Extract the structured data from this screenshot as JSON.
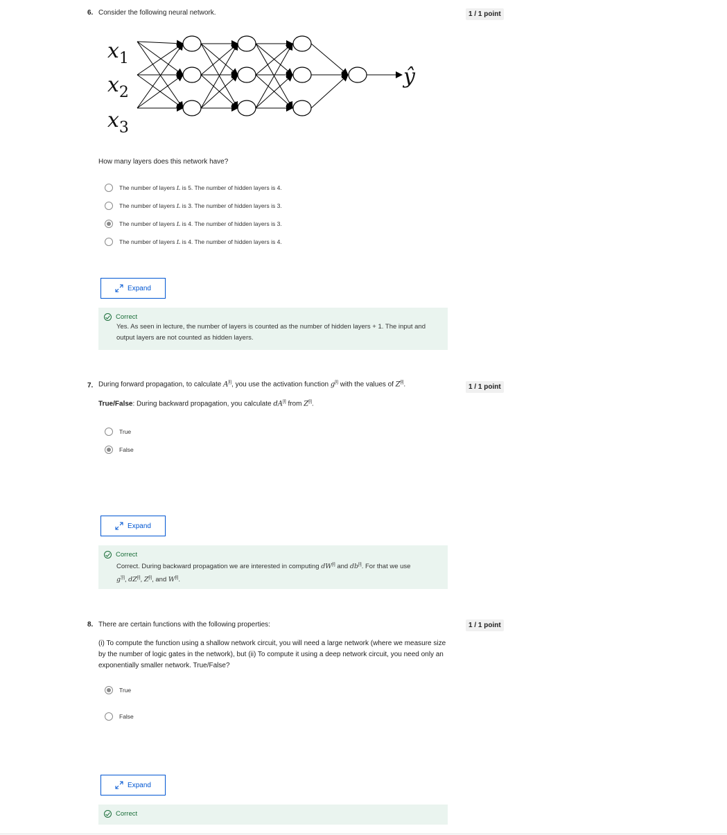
{
  "q6": {
    "number": "6.",
    "prompt": "Consider the following neural network.",
    "points": "1 / 1 point",
    "diagram": {
      "inputs": [
        "x",
        "x",
        "x"
      ],
      "input_subs": [
        "1",
        "2",
        "3"
      ],
      "output": "ŷ"
    },
    "question": "How many layers does this network have?",
    "options": [
      {
        "pre": "The number of layers ",
        "var": "L",
        "post": " is 5. The number of hidden layers is 4.",
        "selected": false
      },
      {
        "pre": "The number of layers ",
        "var": "L",
        "post": " is 3. The number of hidden layers is 3.",
        "selected": false
      },
      {
        "pre": "The number of layers ",
        "var": "L",
        "post": " is 4. The number of hidden layers is 3.",
        "selected": true
      },
      {
        "pre": "The number of layers ",
        "var": "L",
        "post": " is 4. The number of hidden layers is 4.",
        "selected": false
      }
    ],
    "expand_label": "Expand",
    "feedback_title": "Correct",
    "feedback_line1": "Yes. As seen in lecture, the number of layers is counted as the number of hidden layers + 1. The input and",
    "feedback_line2": "output layers are not counted as hidden layers."
  },
  "q7": {
    "number": "7.",
    "points": "1 / 1 point",
    "line1_a": "During forward propagation, to calculate ",
    "line1_A": "A",
    "line1_b": ", you use the activation function ",
    "line1_g": "g",
    "line1_c": " with the values of ",
    "line1_Z": "Z",
    "line1_d": ".",
    "tf_bold": "True/False",
    "line2_a": ": During backward propagation, you calculate ",
    "line2_dA": "dA",
    "line2_b": " from ",
    "line2_Z": "Z",
    "line2_c": ".",
    "sup_l": "[l]",
    "options": [
      {
        "label": "True",
        "selected": false
      },
      {
        "label": "False",
        "selected": true
      }
    ],
    "expand_label": "Expand",
    "feedback_title": "Correct",
    "fb1_a": "Correct. During backward propagation we are interested in computing ",
    "fb1_dW": "dW",
    "fb1_b": " and ",
    "fb1_db": "db",
    "fb1_c": ". For that we use",
    "fb2_g": "g",
    "fb2_gsup": "′[l]",
    "fb2_dZ": "dZ",
    "fb2_Z": "Z",
    "fb2_and": ", and ",
    "fb2_W": "W",
    "fb2_end": "."
  },
  "q8": {
    "number": "8.",
    "points": "1 / 1 point",
    "prompt": "There are certain functions with the following properties:",
    "body1": "(i) To compute the function using a shallow network circuit, you will need a large network (where we measure size",
    "body2": "by the number of logic gates in the network), but (ii) To compute it using a deep network circuit, you need only an",
    "body3": "exponentially smaller network. True/False?",
    "options": [
      {
        "label": "True",
        "selected": true
      },
      {
        "label": "False",
        "selected": false
      }
    ],
    "expand_label": "Expand",
    "feedback_title": "Correct"
  },
  "colors": {
    "accent": "#0056d2",
    "correct_green": "#1b6e3a",
    "feedback_bg": "#eaf4ef",
    "points_bg": "#f0f0f0"
  }
}
